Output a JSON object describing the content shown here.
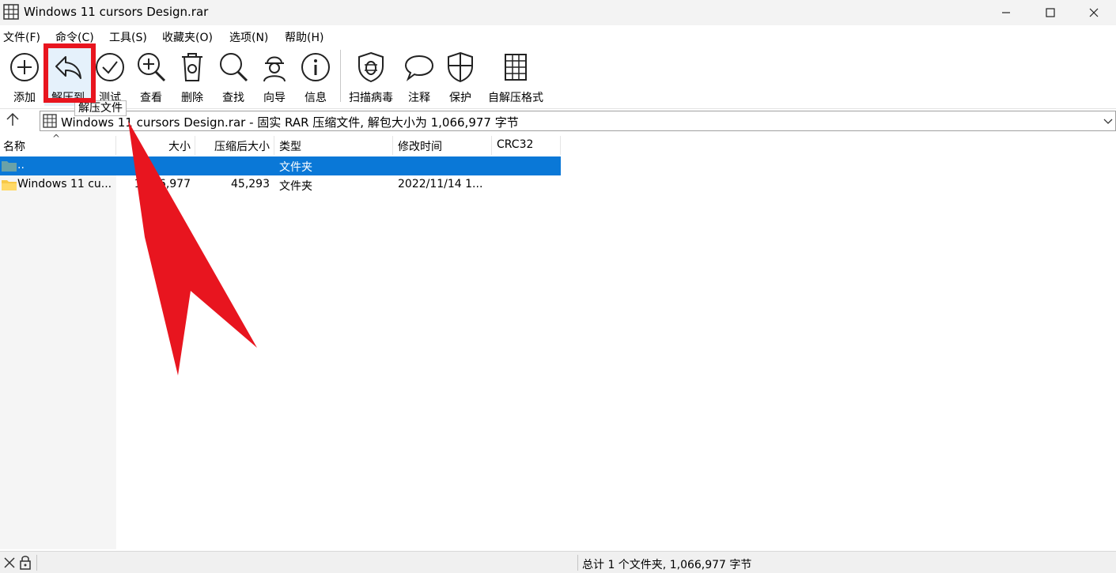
{
  "window": {
    "title": "Windows 11 cursors Design.rar",
    "controls": {
      "minimize": "minimize",
      "maximize": "maximize",
      "close": "close"
    }
  },
  "menu": {
    "items": [
      "文件(F)",
      "命令(C)",
      "工具(S)",
      "收藏夹(O)",
      "选项(N)",
      "帮助(H)"
    ]
  },
  "toolbar": {
    "buttons": [
      {
        "label": "添加",
        "icon": "add-icon"
      },
      {
        "label": "解压到",
        "icon": "extract-to-icon"
      },
      {
        "label": "测试",
        "icon": "test-icon"
      },
      {
        "label": "查看",
        "icon": "view-icon"
      },
      {
        "label": "删除",
        "icon": "delete-icon"
      },
      {
        "label": "查找",
        "icon": "find-icon"
      },
      {
        "label": "向导",
        "icon": "wizard-icon"
      },
      {
        "label": "信息",
        "icon": "info-icon"
      },
      {
        "label": "扫描病毒",
        "icon": "virus-scan-icon"
      },
      {
        "label": "注释",
        "icon": "comment-icon"
      },
      {
        "label": "保护",
        "icon": "protect-icon"
      },
      {
        "label": "自解压格式",
        "icon": "sfx-icon"
      }
    ],
    "tooltip": "解压文件"
  },
  "address": {
    "text": "Windows 11 cursors Design.rar - 固实 RAR 压缩文件, 解包大小为 1,066,977 字节"
  },
  "columns": [
    "名称",
    "大小",
    "压缩后大小",
    "类型",
    "修改时间",
    "CRC32"
  ],
  "rows": [
    {
      "name": "..",
      "size": "",
      "packed": "",
      "type": "文件夹",
      "modified": "",
      "crc": "",
      "selected": true
    },
    {
      "name": "Windows 11 cu...",
      "size": "1,066,977",
      "packed": "45,293",
      "type": "文件夹",
      "modified": "2022/11/14 1...",
      "crc": "",
      "selected": false
    }
  ],
  "status": {
    "summary": "总计 1 个文件夹, 1,066,977 字节"
  },
  "colors": {
    "selection": "#0a78d7",
    "annotation": "#e8151f"
  }
}
